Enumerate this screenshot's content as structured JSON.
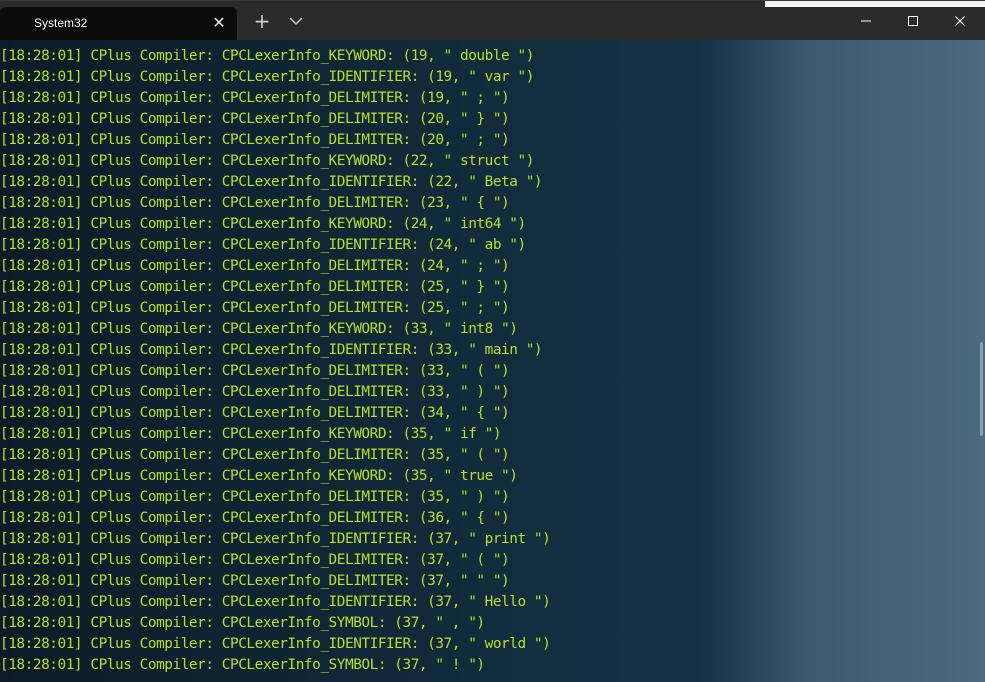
{
  "window": {
    "tab_title": "System32",
    "tab_close": "✕",
    "new_tab": "+",
    "minimize_label": "Minimize",
    "maximize_label": "Maximize",
    "close_label": "Close"
  },
  "colors": {
    "terminal_text": "#b6e02a",
    "titlebar": "#2b2b2b",
    "tab": "#0b0b0b"
  },
  "terminal": {
    "lines": [
      "[18:28:01] CPlus Compiler: CPCLexerInfo_KEYWORD: (19, \" double \")",
      "[18:28:01] CPlus Compiler: CPCLexerInfo_IDENTIFIER: (19, \" var \")",
      "[18:28:01] CPlus Compiler: CPCLexerInfo_DELIMITER: (19, \" ; \")",
      "[18:28:01] CPlus Compiler: CPCLexerInfo_DELIMITER: (20, \" } \")",
      "[18:28:01] CPlus Compiler: CPCLexerInfo_DELIMITER: (20, \" ; \")",
      "[18:28:01] CPlus Compiler: CPCLexerInfo_KEYWORD: (22, \" struct \")",
      "[18:28:01] CPlus Compiler: CPCLexerInfo_IDENTIFIER: (22, \" Beta \")",
      "[18:28:01] CPlus Compiler: CPCLexerInfo_DELIMITER: (23, \" { \")",
      "[18:28:01] CPlus Compiler: CPCLexerInfo_KEYWORD: (24, \" int64 \")",
      "[18:28:01] CPlus Compiler: CPCLexerInfo_IDENTIFIER: (24, \" ab \")",
      "[18:28:01] CPlus Compiler: CPCLexerInfo_DELIMITER: (24, \" ; \")",
      "[18:28:01] CPlus Compiler: CPCLexerInfo_DELIMITER: (25, \" } \")",
      "[18:28:01] CPlus Compiler: CPCLexerInfo_DELIMITER: (25, \" ; \")",
      "[18:28:01] CPlus Compiler: CPCLexerInfo_KEYWORD: (33, \" int8 \")",
      "[18:28:01] CPlus Compiler: CPCLexerInfo_IDENTIFIER: (33, \" main \")",
      "[18:28:01] CPlus Compiler: CPCLexerInfo_DELIMITER: (33, \" ( \")",
      "[18:28:01] CPlus Compiler: CPCLexerInfo_DELIMITER: (33, \" ) \")",
      "[18:28:01] CPlus Compiler: CPCLexerInfo_DELIMITER: (34, \" { \")",
      "[18:28:01] CPlus Compiler: CPCLexerInfo_KEYWORD: (35, \" if \")",
      "[18:28:01] CPlus Compiler: CPCLexerInfo_DELIMITER: (35, \" ( \")",
      "[18:28:01] CPlus Compiler: CPCLexerInfo_KEYWORD: (35, \" true \")",
      "[18:28:01] CPlus Compiler: CPCLexerInfo_DELIMITER: (35, \" ) \")",
      "[18:28:01] CPlus Compiler: CPCLexerInfo_DELIMITER: (36, \" { \")",
      "[18:28:01] CPlus Compiler: CPCLexerInfo_IDENTIFIER: (37, \" print \")",
      "[18:28:01] CPlus Compiler: CPCLexerInfo_DELIMITER: (37, \" ( \")",
      "[18:28:01] CPlus Compiler: CPCLexerInfo_DELIMITER: (37, \" \" \")",
      "[18:28:01] CPlus Compiler: CPCLexerInfo_IDENTIFIER: (37, \" Hello \")",
      "[18:28:01] CPlus Compiler: CPCLexerInfo_SYMBOL: (37, \" , \")",
      "[18:28:01] CPlus Compiler: CPCLexerInfo_IDENTIFIER: (37, \" world \")",
      "[18:28:01] CPlus Compiler: CPCLexerInfo_SYMBOL: (37, \" ! \")"
    ]
  },
  "icons": {
    "minimize": "minimize-icon",
    "maximize": "maximize-icon",
    "close": "close-icon",
    "dropdown": "chevron-down-icon",
    "new_tab": "plus-icon"
  }
}
